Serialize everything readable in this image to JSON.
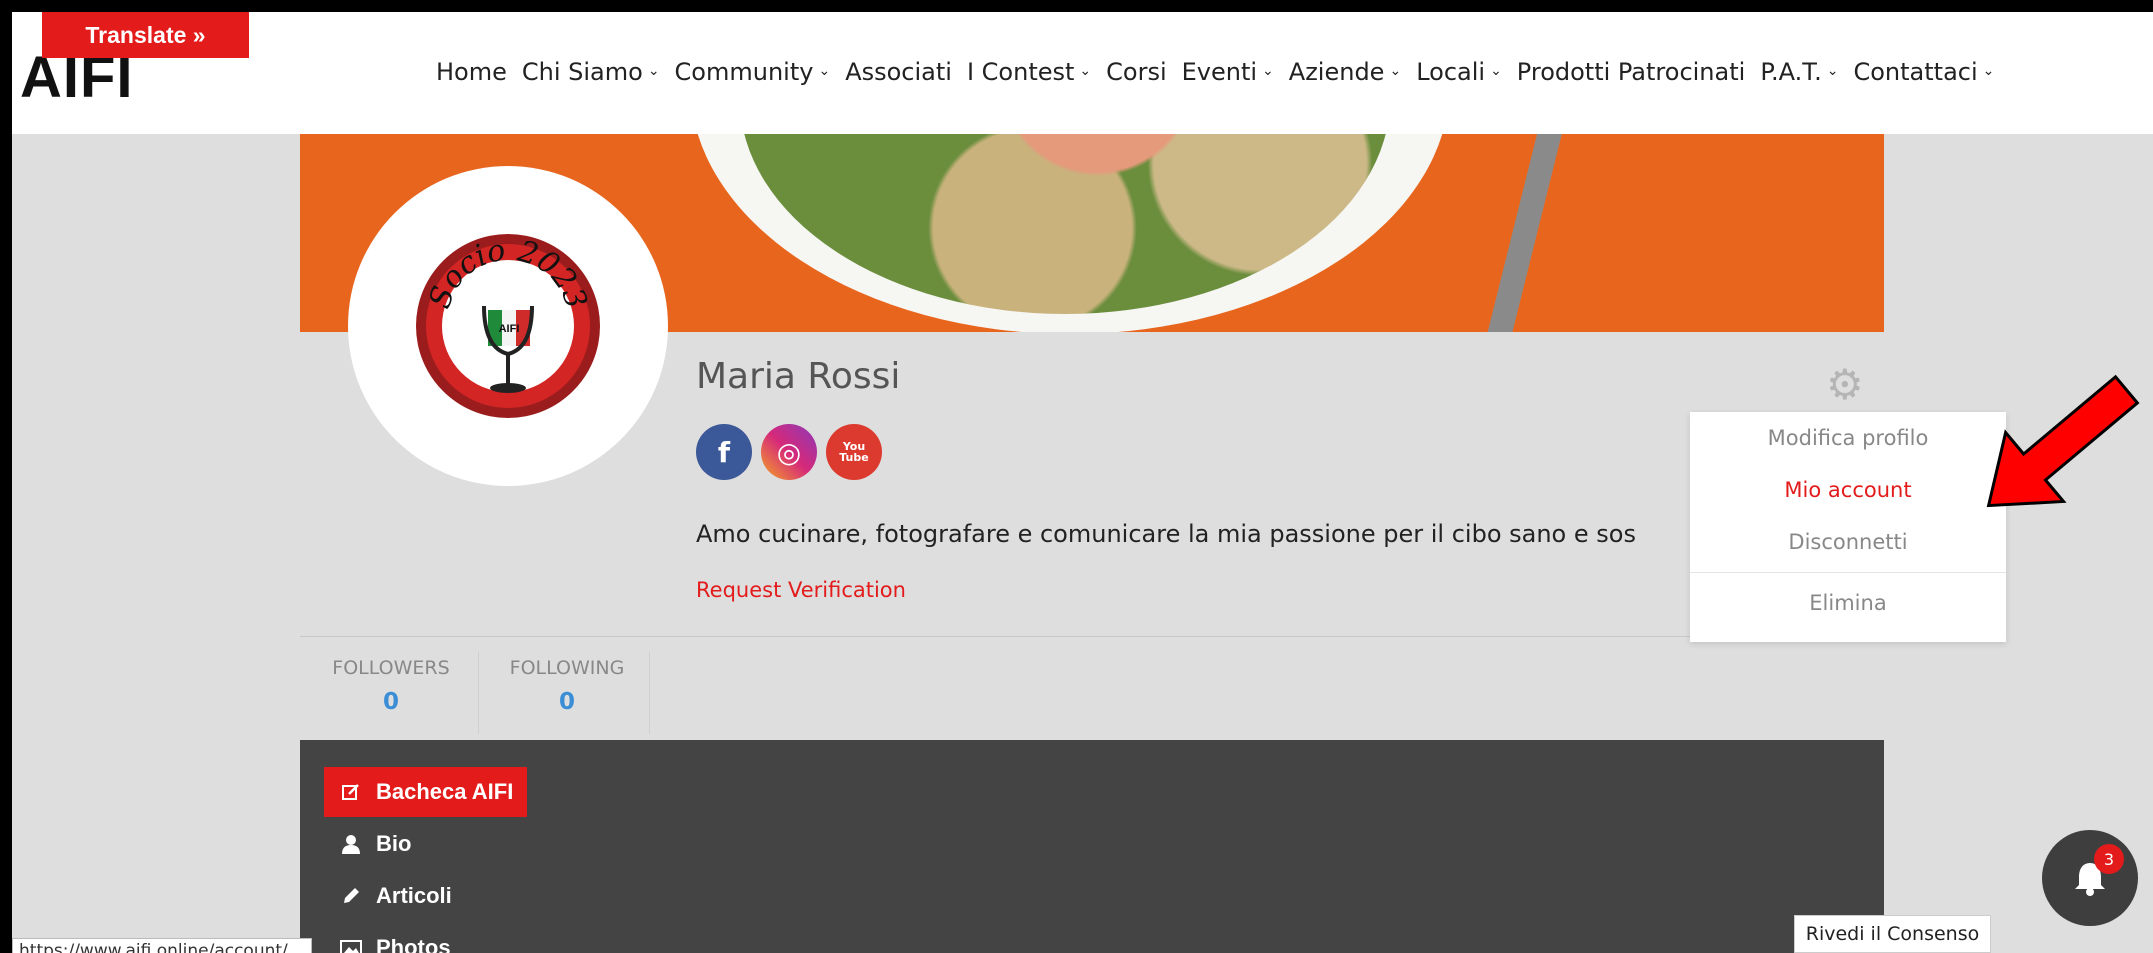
{
  "header": {
    "logo_text": "AIFI",
    "translate_label": "Translate »",
    "nav": [
      {
        "label": "Home",
        "dropdown": false
      },
      {
        "label": "Chi Siamo",
        "dropdown": true
      },
      {
        "label": "Community",
        "dropdown": true
      },
      {
        "label": "Associati",
        "dropdown": false
      },
      {
        "label": "I Contest",
        "dropdown": true
      },
      {
        "label": "Corsi",
        "dropdown": false
      },
      {
        "label": "Eventi",
        "dropdown": true
      },
      {
        "label": "Aziende",
        "dropdown": true
      },
      {
        "label": "Locali",
        "dropdown": true
      },
      {
        "label": "Prodotti Patrocinati",
        "dropdown": false
      },
      {
        "label": "P.A.T.",
        "dropdown": true
      },
      {
        "label": "Contattaci",
        "dropdown": true
      }
    ]
  },
  "avatar": {
    "badge_text": "Socio 2023",
    "badge_inner": "AIFI"
  },
  "profile": {
    "name": "Maria Rossi",
    "socials": [
      {
        "name": "facebook",
        "glyph": "f",
        "color": "#3b5998"
      },
      {
        "name": "instagram",
        "glyph": "◎",
        "color": "#d6297a"
      },
      {
        "name": "youtube",
        "glyph": "You\nTube",
        "color": "#dd3a2f"
      }
    ],
    "bio": "Amo cucinare, fotografare e comunicare la mia passione per il cibo sano e sos",
    "request_verification": "Request Verification"
  },
  "stats": [
    {
      "label": "FOLLOWERS",
      "value": "0"
    },
    {
      "label": "FOLLOWING",
      "value": "0"
    }
  ],
  "tabs": [
    {
      "label": "Bacheca AIFI",
      "icon": "edit-icon",
      "active": true
    },
    {
      "label": "Bio",
      "icon": "user-icon",
      "active": false
    },
    {
      "label": "Articoli",
      "icon": "pencil-icon",
      "active": false
    },
    {
      "label": "Photos",
      "icon": "image-icon",
      "active": false
    }
  ],
  "settings_menu": {
    "items": [
      "Modifica profilo",
      "Mio account",
      "Disconnetti",
      "Elimina"
    ],
    "highlighted": "Mio account"
  },
  "notifications": {
    "count": "3"
  },
  "consent_label": "Rivedi il Consenso",
  "status_url": "https://www.aifi.online/account/",
  "colors": {
    "accent": "#e31b1b",
    "stat_value": "#3b8ed6",
    "cover": "#e8651d",
    "tabs_bg": "#444444"
  }
}
